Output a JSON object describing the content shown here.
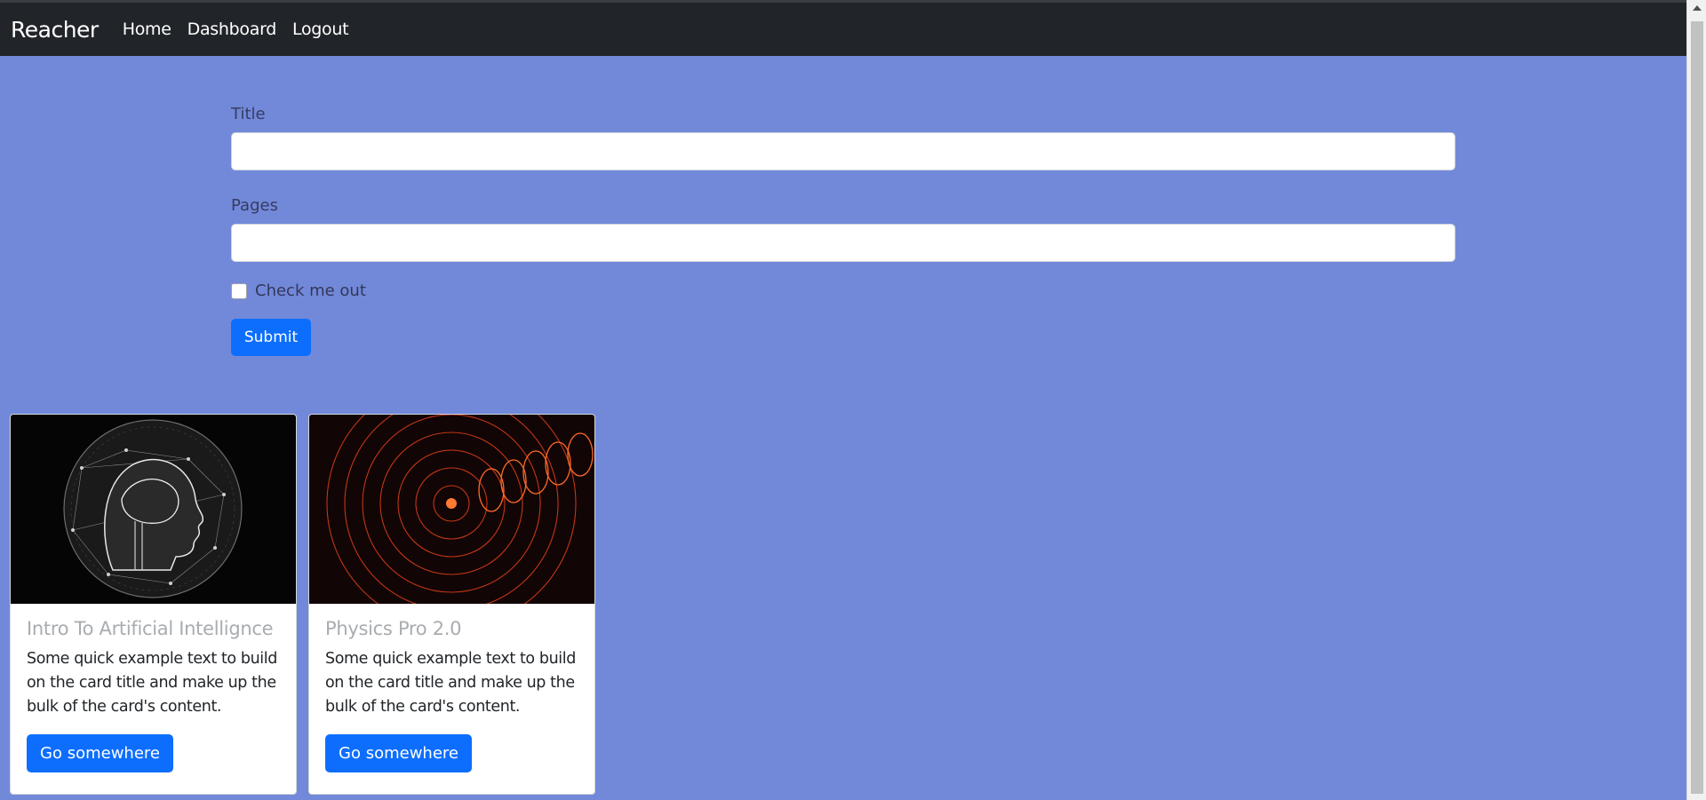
{
  "navbar": {
    "brand": "Reacher",
    "links": [
      "Home",
      "Dashboard",
      "Logout"
    ]
  },
  "form": {
    "title_label": "Title",
    "title_value": "",
    "pages_label": "Pages",
    "pages_value": "",
    "checkbox_label": "Check me out",
    "checkbox_checked": false,
    "submit_label": "Submit"
  },
  "cards": [
    {
      "image": "ai-head-illustration",
      "title": "Intro To Artificial Intellignce",
      "text": "Some quick example text to build on the card title and make up the bulk of the card's content.",
      "button": "Go somewhere"
    },
    {
      "image": "red-spiral-physics-illustration",
      "title": "Physics Pro 2.0",
      "text": "Some quick example text to build on the card title and make up the bulk of the card's content.",
      "button": "Go somewhere"
    }
  ],
  "colors": {
    "page_background": "#7289da",
    "navbar": "#212529",
    "primary": "#0d6efd"
  }
}
